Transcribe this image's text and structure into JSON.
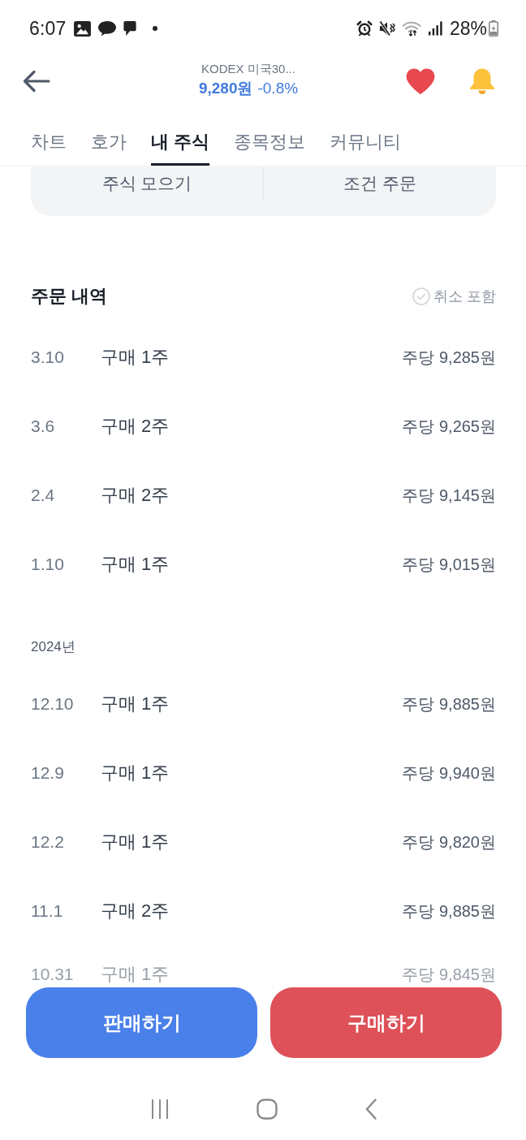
{
  "status_bar": {
    "time": "6:07",
    "battery": "28%"
  },
  "header": {
    "title": "KODEX 미국30...",
    "price": "9,280원",
    "change": "-0.8%",
    "favorited": true
  },
  "tabs": [
    {
      "label": "차트",
      "selected": false
    },
    {
      "label": "호가",
      "selected": false
    },
    {
      "label": "내 주식",
      "selected": true
    },
    {
      "label": "종목정보",
      "selected": false
    },
    {
      "label": "커뮤니티",
      "selected": false
    }
  ],
  "order_tools": [
    {
      "label": "주식 모으기"
    },
    {
      "label": "조건 주문"
    }
  ],
  "order_history": {
    "title": "주문 내역",
    "include_canceled": {
      "label": "취소 포함",
      "checked": false
    },
    "groups": [
      {
        "orders": [
          {
            "date": "3.10",
            "action": "구매 1주",
            "price": "주당 9,285원",
            "faded": false
          },
          {
            "date": "3.6",
            "action": "구매 2주",
            "price": "주당 9,265원",
            "faded": false
          },
          {
            "date": "2.4",
            "action": "구매 2주",
            "price": "주당 9,145원",
            "faded": false
          },
          {
            "date": "1.10",
            "action": "구매 1주",
            "price": "주당 9,015원",
            "faded": false
          }
        ]
      },
      {
        "label": "2024년",
        "orders": [
          {
            "date": "12.10",
            "action": "구매 1주",
            "price": "주당 9,885원",
            "faded": false
          },
          {
            "date": "12.9",
            "action": "구매 1주",
            "price": "주당 9,940원",
            "faded": false
          },
          {
            "date": "12.2",
            "action": "구매 1주",
            "price": "주당 9,820원",
            "faded": false
          },
          {
            "date": "11.1",
            "action": "구매 2주",
            "price": "주당 9,885원",
            "faded": false
          },
          {
            "date": "10.31",
            "action": "구매 1주",
            "price": "주당 9,845원",
            "faded": true
          }
        ]
      }
    ]
  },
  "actions": [
    {
      "label": "판매하기",
      "kind": "sell"
    },
    {
      "label": "구매하기",
      "kind": "buy"
    }
  ]
}
